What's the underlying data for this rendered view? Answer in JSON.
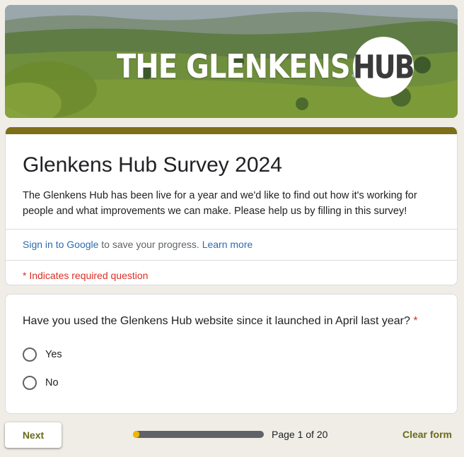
{
  "banner": {
    "logo_text": "THE GLENKENS",
    "logo_circle_text": "HUB"
  },
  "form": {
    "title": "Glenkens Hub Survey 2024",
    "description": "The Glenkens Hub has been live for a year and we'd like to find out how it's working for people and what improvements we can make. Please help us by filling in this survey!",
    "signin_link": "Sign in to Google",
    "signin_text": " to save your progress. ",
    "learn_more": "Learn more",
    "required_note": "* Indicates required question"
  },
  "question": {
    "text": "Have you used the Glenkens Hub website since it launched in April last year?",
    "required_mark": "*",
    "options": [
      "Yes",
      "No"
    ]
  },
  "footer": {
    "next_label": "Next",
    "progress_fraction": 0.05,
    "page_text": "Page 1 of 20",
    "clear_label": "Clear form"
  },
  "colors": {
    "accent": "#7c6f17",
    "required": "#d93025",
    "link": "#2b6cb0",
    "progress": "#f2b600"
  }
}
